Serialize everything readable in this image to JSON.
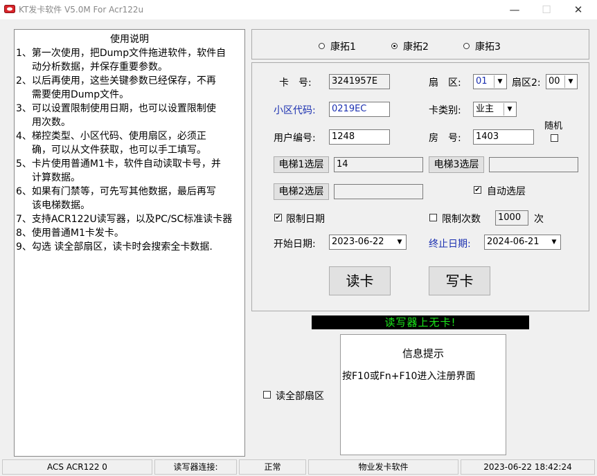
{
  "window": {
    "title": "KT发卡软件 V5.0M For Acr122u"
  },
  "instructions": {
    "title": "使用说明",
    "lines": [
      "1、第一次使用，把Dump文件拖进软件，软件自",
      "动分析数据，并保存重要参数。",
      "2、以后再使用，这些关键参数已经保存，不再",
      "需要使用Dump文件。",
      "3、可以设置限制使用日期，也可以设置限制使",
      "用次数。",
      "4、梯控类型、小区代码、使用扇区，必须正",
      "确，可以从文件获取，也可以手工填写。",
      "5、卡片使用普通M1卡，软件自动读取卡号，并",
      "计算数据。",
      "6、如果有门禁等，可先写其他数据，最后再写",
      "该电梯数据。",
      "7、支持ACR122U读写器，以及PC/SC标准读卡器",
      "8、使用普通M1卡发卡。",
      "9、勾选 读全部扇区，读卡时会搜索全卡数据."
    ]
  },
  "radios": [
    {
      "label": "康拓1",
      "selected": false
    },
    {
      "label": "康拓2",
      "selected": true
    },
    {
      "label": "康拓3",
      "selected": false
    }
  ],
  "form": {
    "card_no_label": "卡　号:",
    "card_no_value": "3241957E",
    "sector_label": "扇　区:",
    "sector_value": "01",
    "sector2_label": "扇区2:",
    "sector2_value": "00",
    "community_label": "小区代码:",
    "community_value": "0219EC",
    "card_type_label": "卡类别:",
    "card_type_value": "业主",
    "random_label": "随机",
    "user_no_label": "用户编号:",
    "user_no_value": "1248",
    "room_label": "房　号:",
    "room_value": "1403",
    "elevator1_button": "电梯1选层",
    "elevator1_value": "14",
    "elevator3_button": "电梯3选层",
    "elevator3_value": "",
    "elevator2_button": "电梯2选层",
    "elevator2_value": "",
    "auto_floor_label": "自动选层",
    "auto_floor_checked": true,
    "limit_date_label": "限制日期",
    "limit_date_checked": true,
    "limit_count_label": "限制次数",
    "limit_count_checked": false,
    "limit_count_value": "1000",
    "limit_count_unit": "次",
    "start_date_label": "开始日期:",
    "start_date_value": "2023-06-22",
    "end_date_label": "终止日期:",
    "end_date_value": "2024-06-21",
    "read_button": "读卡",
    "write_button": "写卡"
  },
  "reader_status": "读写器上无卡!",
  "read_all_label": "读全部扇区",
  "read_all_checked": false,
  "info": {
    "title": "信息提示",
    "message": "按F10或Fn+F10进入注册界面"
  },
  "statusbar": {
    "device": "ACS ACR122 0",
    "conn_label": "读写器连接:",
    "conn_status": "正常",
    "app_name": "物业发卡软件",
    "datetime": "2023-06-22 18:42:24"
  },
  "colors": {
    "status_bg": "#000000",
    "status_text": "#19e619",
    "accent_blue": "#1a2fb0"
  }
}
